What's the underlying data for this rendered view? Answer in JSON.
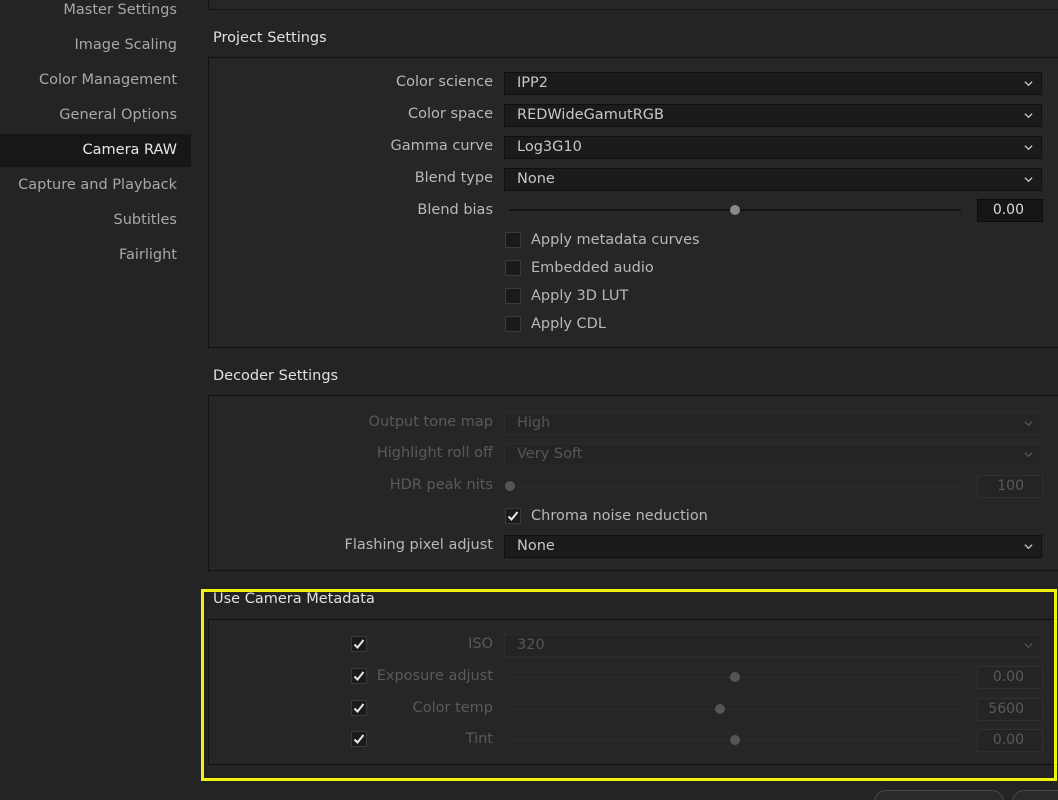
{
  "sidebar": {
    "items": [
      {
        "label": "Master Settings"
      },
      {
        "label": "Image Scaling"
      },
      {
        "label": "Color Management"
      },
      {
        "label": "General Options"
      },
      {
        "label": "Camera RAW",
        "active": true
      },
      {
        "label": "Capture and Playback"
      },
      {
        "label": "Subtitles"
      },
      {
        "label": "Fairlight"
      }
    ]
  },
  "project_settings": {
    "title": "Project Settings",
    "color_science": {
      "label": "Color science",
      "value": "IPP2"
    },
    "color_space": {
      "label": "Color space",
      "value": "REDWideGamutRGB"
    },
    "gamma_curve": {
      "label": "Gamma curve",
      "value": "Log3G10"
    },
    "blend_type": {
      "label": "Blend type",
      "value": "None"
    },
    "blend_bias": {
      "label": "Blend bias",
      "value": "0.00",
      "slider_fraction": 0.5
    },
    "apply_metadata_curves": {
      "label": "Apply metadata curves",
      "checked": false
    },
    "embedded_audio": {
      "label": "Embedded audio",
      "checked": false
    },
    "apply_3d_lut": {
      "label": "Apply 3D LUT",
      "checked": false
    },
    "apply_cdl": {
      "label": "Apply CDL",
      "checked": false
    }
  },
  "decoder_settings": {
    "title": "Decoder Settings",
    "output_tone_map": {
      "label": "Output tone map",
      "value": "High",
      "enabled": false
    },
    "highlight_roll_off": {
      "label": "Highlight roll off",
      "value": "Very Soft",
      "enabled": false
    },
    "hdr_peak_nits": {
      "label": "HDR peak nits",
      "value": "100",
      "slider_fraction": 0.0,
      "enabled": false
    },
    "chroma_noise_reduction": {
      "label": "Chroma noise neduction",
      "checked": true
    },
    "flashing_pixel_adjust": {
      "label": "Flashing pixel adjust",
      "value": "None"
    }
  },
  "use_camera_metadata": {
    "title": "Use Camera Metadata",
    "iso": {
      "label": "ISO",
      "value": "320",
      "checked": true,
      "enabled": false
    },
    "exposure_adjust": {
      "label": "Exposure adjust",
      "value": "0.00",
      "checked": true,
      "slider_fraction": 0.5,
      "enabled": false
    },
    "color_temp": {
      "label": "Color temp",
      "value": "5600",
      "checked": true,
      "slider_fraction": 0.47,
      "enabled": false
    },
    "tint": {
      "label": "Tint",
      "value": "0.00",
      "checked": true,
      "slider_fraction": 0.5,
      "enabled": false
    }
  },
  "colors": {
    "highlight": "#f2f20e",
    "background": "#242424",
    "panel": "#262626"
  },
  "icons": {
    "dropdown": "chevron-down-icon",
    "check": "check-icon"
  }
}
